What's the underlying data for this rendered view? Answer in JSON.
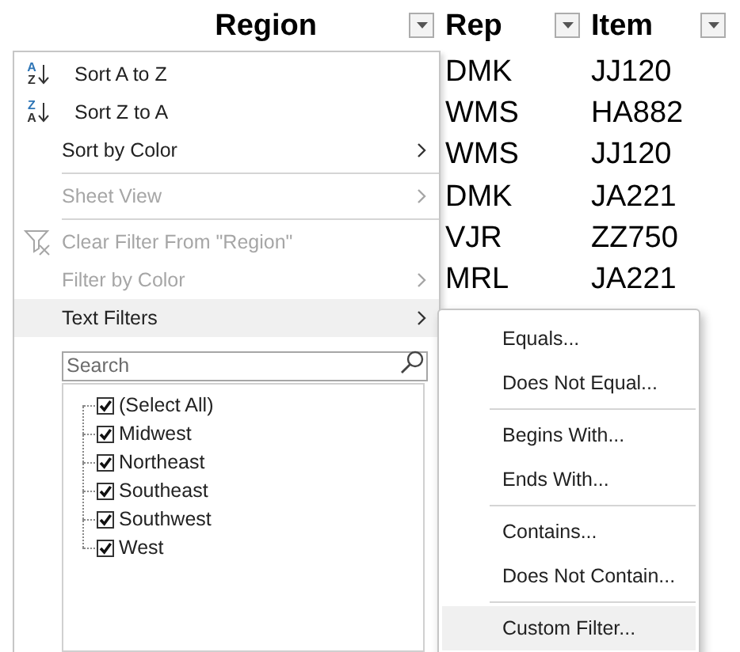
{
  "sheet": {
    "columns": [
      {
        "header": "Region"
      },
      {
        "header": "Rep"
      },
      {
        "header": "Item"
      }
    ],
    "rows": [
      {
        "rep": "DMK",
        "item": "JJ120"
      },
      {
        "rep": "WMS",
        "item": "HA882"
      },
      {
        "rep": "WMS",
        "item": "JJ120"
      },
      {
        "rep": "DMK",
        "item": "JA221"
      },
      {
        "rep": "VJR",
        "item": "ZZ750"
      },
      {
        "rep": "MRL",
        "item": "JA221"
      }
    ]
  },
  "filter_menu": {
    "groups": [
      [
        {
          "label": "Sort A to Z",
          "kind": "sort",
          "icon_top": "A",
          "icon_bottom": "Z",
          "disabled": false,
          "submenu": false,
          "highlighted": false
        },
        {
          "label": "Sort Z to A",
          "kind": "sort",
          "icon_top": "Z",
          "icon_bottom": "A",
          "disabled": false,
          "submenu": false,
          "highlighted": false
        },
        {
          "label": "Sort by Color",
          "kind": "plain",
          "disabled": false,
          "submenu": true,
          "highlighted": false
        }
      ],
      [
        {
          "label": "Sheet View",
          "kind": "plain",
          "disabled": true,
          "submenu": true,
          "highlighted": false
        }
      ],
      [
        {
          "label": "Clear Filter From \"Region\"",
          "kind": "clear_filter",
          "disabled": true,
          "submenu": false,
          "highlighted": false
        },
        {
          "label": "Filter by Color",
          "kind": "plain",
          "disabled": true,
          "submenu": true,
          "highlighted": false
        },
        {
          "label": "Text Filters",
          "kind": "plain",
          "disabled": false,
          "submenu": true,
          "highlighted": true
        }
      ]
    ],
    "search": {
      "placeholder": "Search"
    },
    "values": [
      {
        "label": "(Select All)",
        "checked": true
      },
      {
        "label": "Midwest",
        "checked": true
      },
      {
        "label": "Northeast",
        "checked": true
      },
      {
        "label": "Southeast",
        "checked": true
      },
      {
        "label": "Southwest",
        "checked": true
      },
      {
        "label": "West",
        "checked": true
      }
    ]
  },
  "text_filters_submenu": {
    "groups": [
      [
        {
          "label": "Equals...",
          "highlighted": false
        },
        {
          "label": "Does Not Equal...",
          "highlighted": false
        }
      ],
      [
        {
          "label": "Begins With...",
          "highlighted": false
        },
        {
          "label": "Ends With...",
          "highlighted": false
        }
      ],
      [
        {
          "label": "Contains...",
          "highlighted": false
        },
        {
          "label": "Does Not Contain...",
          "highlighted": false
        }
      ],
      [
        {
          "label": "Custom Filter...",
          "highlighted": true
        }
      ]
    ]
  }
}
